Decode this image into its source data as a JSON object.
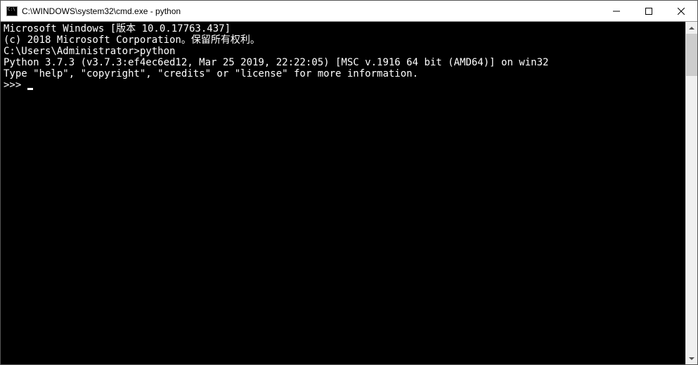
{
  "window": {
    "title": "C:\\WINDOWS\\system32\\cmd.exe - python"
  },
  "terminal": {
    "lines": [
      "Microsoft Windows [版本 10.0.17763.437]",
      "(c) 2018 Microsoft Corporation。保留所有权利。",
      "",
      "C:\\Users\\Administrator>python",
      "Python 3.7.3 (v3.7.3:ef4ec6ed12, Mar 25 2019, 22:22:05) [MSC v.1916 64 bit (AMD64)] on win32",
      "Type \"help\", \"copyright\", \"credits\" or \"license\" for more information."
    ],
    "prompt": ">>> "
  }
}
